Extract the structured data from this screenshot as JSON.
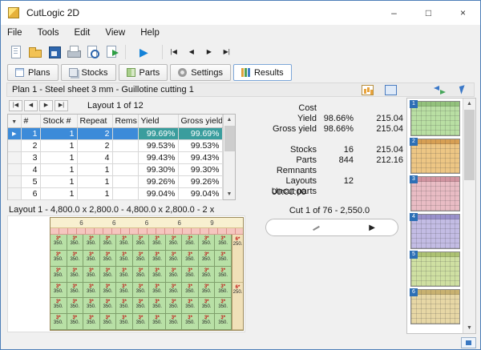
{
  "window": {
    "title": "CutLogic 2D",
    "controls": {
      "minimize": "–",
      "maximize": "□",
      "close": "×"
    }
  },
  "menu": {
    "items": [
      "File",
      "Tools",
      "Edit",
      "View",
      "Help"
    ]
  },
  "toolbar": {
    "run_glyph": "▶",
    "nav": {
      "first": "|◀",
      "prev": "◀",
      "next": "▶",
      "last": "▶|"
    }
  },
  "icons": {
    "filter": "▼",
    "up": "▲",
    "down": "▼",
    "row_pointer": "▶",
    "toolbar_names": [
      "new",
      "open",
      "save",
      "print",
      "preview",
      "export"
    ]
  },
  "tabs": [
    {
      "label": "Plans",
      "icon": "plans-icon"
    },
    {
      "label": "Stocks",
      "icon": "stocks-icon"
    },
    {
      "label": "Parts",
      "icon": "parts-icon"
    },
    {
      "label": "Settings",
      "icon": "settings-icon"
    },
    {
      "label": "Results",
      "icon": "results-icon",
      "active": true
    }
  ],
  "plan_bar": {
    "title": "Plan 1  -  Steel sheet 3 mm  -  Guillotine cutting 1"
  },
  "layout_nav": {
    "first": "|◀",
    "prev": "◀",
    "next": "▶",
    "last": "▶|",
    "label": "Layout 1 of 12"
  },
  "results_table": {
    "columns": [
      "#",
      "Stock #",
      "Repeat",
      "Rems",
      "Yield",
      "Gross yield"
    ],
    "rows": [
      {
        "num": "1",
        "stock": "1",
        "repeat": "2",
        "rems": "",
        "yield_pct": "99.69%",
        "gross_yield": "99.69%",
        "selected": true
      },
      {
        "num": "2",
        "stock": "1",
        "repeat": "2",
        "rems": "",
        "yield_pct": "99.53%",
        "gross_yield": "99.53%"
      },
      {
        "num": "3",
        "stock": "1",
        "repeat": "4",
        "rems": "",
        "yield_pct": "99.43%",
        "gross_yield": "99.43%"
      },
      {
        "num": "4",
        "stock": "1",
        "repeat": "1",
        "rems": "",
        "yield_pct": "99.30%",
        "gross_yield": "99.30%"
      },
      {
        "num": "5",
        "stock": "1",
        "repeat": "1",
        "rems": "",
        "yield_pct": "99.26%",
        "gross_yield": "99.26%"
      },
      {
        "num": "6",
        "stock": "1",
        "repeat": "1",
        "rems": "",
        "yield_pct": "99.04%",
        "gross_yield": "99.04%"
      }
    ]
  },
  "stats": {
    "rows": [
      {
        "label": "Cost",
        "v1": "",
        "v2": ""
      },
      {
        "label": "Yield",
        "v1": "98.66%",
        "v2": "215.04"
      },
      {
        "label": "Gross yield",
        "v1": "98.66%",
        "v2": "215.04"
      },
      {
        "label": "",
        "v1": "",
        "v2": ""
      },
      {
        "label": "Stocks",
        "v1": "16",
        "v2": "215.04"
      },
      {
        "label": "Parts",
        "v1": "844",
        "v2": "212.16"
      },
      {
        "label": "Remnants",
        "v1": "",
        "v2": ""
      },
      {
        "label": "Layouts",
        "v1": "12",
        "v2": ""
      },
      {
        "label": "Uncut parts",
        "v1": "",
        "v2": ""
      }
    ],
    "time": "00:00:00"
  },
  "layout_section": {
    "title": "Layout 1  -  4,800.0 x 2,800.0  -  4,800.0 x 2,800.0  -  2 x"
  },
  "diagram": {
    "header_labels": [
      "6",
      "6",
      "6",
      "6",
      "9"
    ],
    "grid": {
      "cols": 11,
      "rows": 6,
      "cell_top": "3*",
      "cell_bottom": "350."
    },
    "right_cells": [
      {
        "top": "6*",
        "bottom": "250."
      },
      {
        "top": "6*",
        "bottom": "250."
      }
    ],
    "colors": {
      "cell_bg": "#b8e0a6",
      "header_bg": "#f8f0d0",
      "strip_bg": "#f5c6bf",
      "right_bg": "#f0e0b8",
      "mark": "#c11111"
    }
  },
  "cut_panel": {
    "label": "Cut 1 of 76  -  2,550.0",
    "play": "▶"
  },
  "thumbnails": {
    "badge_color": "#2d6fb5",
    "items": [
      {
        "num": "1",
        "bg": "#b9dfa3",
        "accent": "#8fbf78"
      },
      {
        "num": "2",
        "bg": "#edc684",
        "accent": "#d49a4e"
      },
      {
        "num": "3",
        "bg": "#e9bcc4",
        "accent": "#cf8f9c"
      },
      {
        "num": "4",
        "bg": "#c3bce4",
        "accent": "#968dc9"
      },
      {
        "num": "5",
        "bg": "#cfe0a2",
        "accent": "#a8bf6e"
      },
      {
        "num": "6",
        "bg": "#e7d7a5",
        "accent": "#c4ad6a"
      }
    ]
  }
}
